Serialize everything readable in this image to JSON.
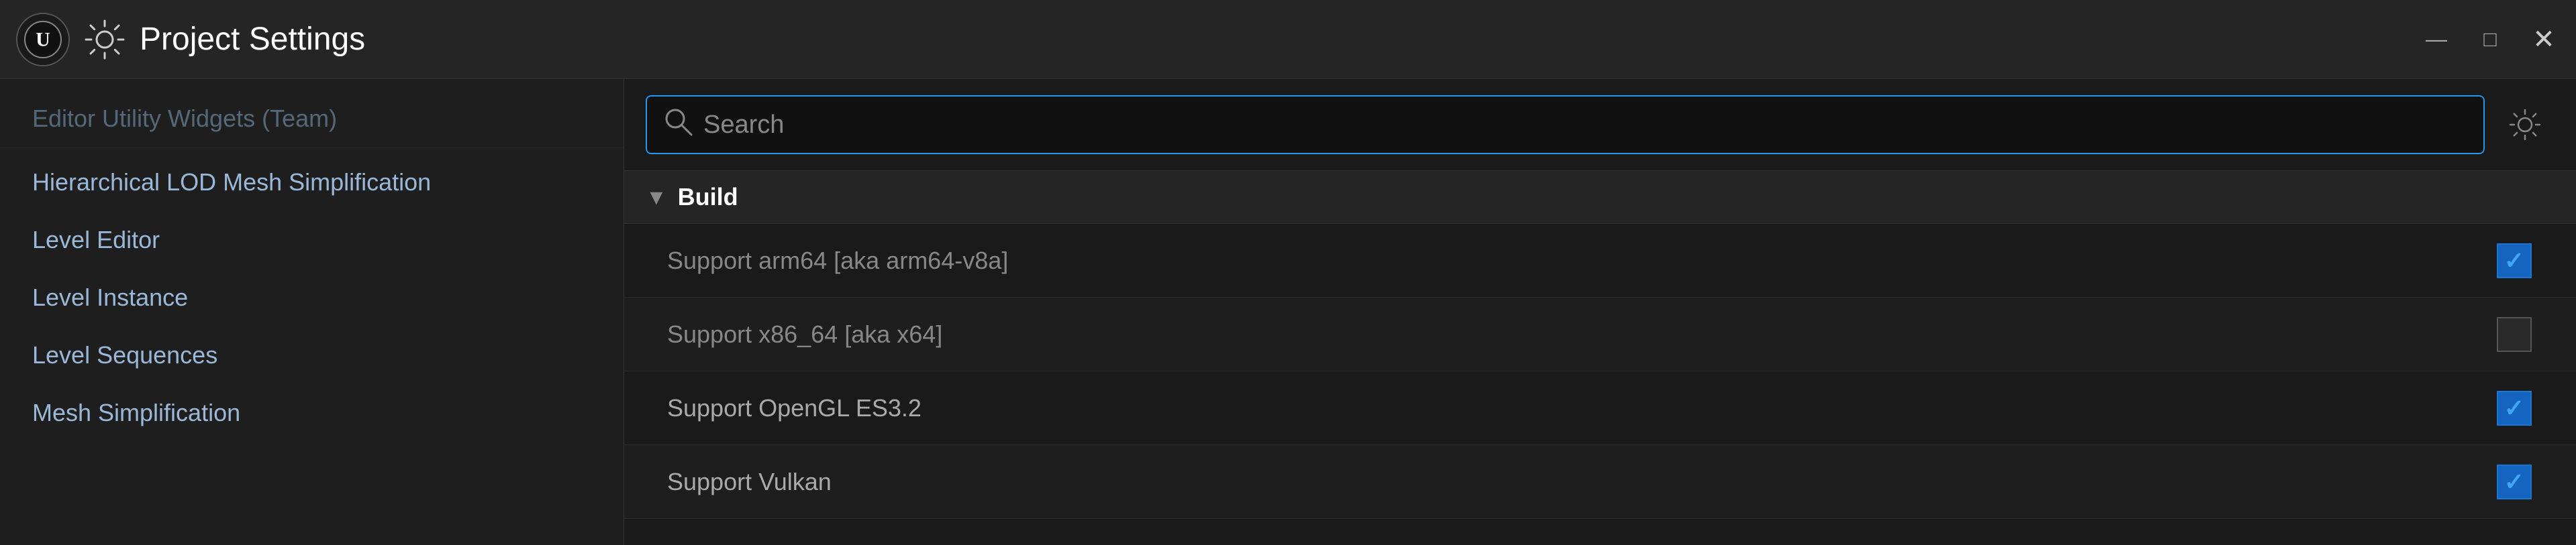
{
  "titleBar": {
    "title": "Project Settings",
    "minimizeLabel": "minimize",
    "maximizeLabel": "maximize",
    "closeLabel": "close",
    "closeX": "×"
  },
  "sidebar": {
    "items": [
      {
        "label": "Editor Utility Widgets (Team)",
        "partial": true
      },
      {
        "label": "Hierarchical LOD Mesh Simplification",
        "partial": false
      },
      {
        "label": "Level Editor",
        "partial": false
      },
      {
        "label": "Level Instance",
        "partial": false
      },
      {
        "label": "Level Sequences",
        "partial": false
      },
      {
        "label": "Mesh Simplification",
        "partial": false
      }
    ]
  },
  "search": {
    "placeholder": "Search"
  },
  "settings": {
    "sectionTitle": "Build",
    "rows": [
      {
        "label": "Support arm64 [aka arm64-v8a]",
        "checked": true,
        "dimmed": true
      },
      {
        "label": "Support x86_64 [aka x64]",
        "checked": false,
        "dimmed": true
      },
      {
        "label": "Support OpenGL ES3.2",
        "checked": true,
        "dimmed": false
      },
      {
        "label": "Support Vulkan",
        "checked": true,
        "dimmed": false
      }
    ]
  },
  "colors": {
    "accent": "#2196f3",
    "checkboxChecked": "#1565c0",
    "checkmark": "#42a5f5"
  }
}
